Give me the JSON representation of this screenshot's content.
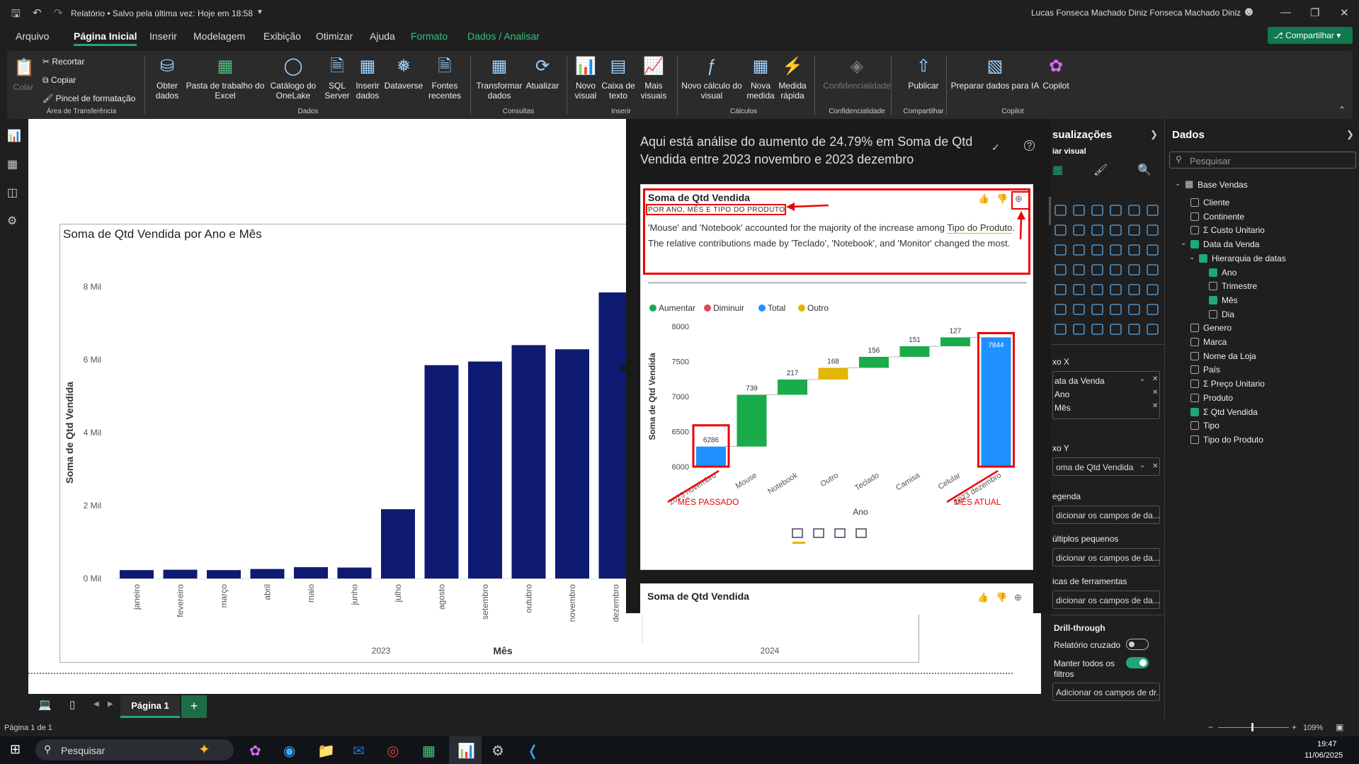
{
  "titlebar": {
    "title": "Relatório • Salvo pela última vez: Hoje em 18:58",
    "user": "Lucas Fonseca Machado Diniz Fonseca Machado Diniz"
  },
  "menu": {
    "tabs": [
      "Arquivo",
      "Página Inicial",
      "Inserir",
      "Modelagem",
      "Exibição",
      "Otimizar",
      "Ajuda",
      "Formato",
      "Dados / Analisar"
    ],
    "share": "Compartilhar"
  },
  "ribbon": {
    "clipboard": {
      "colar": "Colar",
      "recortar": "Recortar",
      "copiar": "Copiar",
      "pincel": "Pincel de formatação",
      "group": "Área de Transferência"
    },
    "dados": {
      "obter": "Obter dados",
      "excel": "Pasta de trabalho do Excel",
      "onelake": "Catálogo do OneLake",
      "sql": "SQL Server",
      "inserir": "Inserir dados",
      "dataverse": "Dataverse",
      "fontes": "Fontes recentes",
      "group": "Dados"
    },
    "consultas": {
      "transformar": "Transformar dados",
      "atualizar": "Atualizar",
      "group": "Consultas"
    },
    "inserir": {
      "novo": "Novo visual",
      "caixa": "Caixa de texto",
      "mais": "Mais visuais",
      "group": "Inserir"
    },
    "calculos": {
      "calc": "Novo cálculo do visual",
      "medida": "Nova medida",
      "rapida": "Medida rápida",
      "group": "Cálculos"
    },
    "conf": {
      "label": "Confidencialidade",
      "group": "Confidencialidade"
    },
    "compart": {
      "publicar": "Publicar",
      "group": "Compartilhar"
    },
    "copilot": {
      "preparar": "Preparar dados para IA",
      "copilot": "Copilot",
      "group": "Copilot"
    }
  },
  "main_chart": {
    "title": "Soma de Qtd Vendida por Ano e Mês",
    "xlabel": "Mês",
    "ylabel": "Soma de Qtd Vendida"
  },
  "qa": {
    "header": "Aqui está análise do aumento de 24.79% em Soma de Qtd Vendida entre 2023 novembro e 2023 dezembro",
    "card_title": "Soma de Qtd Vendida",
    "card_sub": "POR ANO, MÊS E TIPO DO PRODUTO",
    "text1": "'Mouse' and 'Notebook' accounted for the majority of the increase among",
    "text_link": "Tipo do Produto",
    "text2": ". The relative contributions made by 'Teclado', 'Notebook', and 'Monitor' changed the most.",
    "legend": [
      "Aumentar",
      "Diminuir",
      "Total",
      "Outro"
    ],
    "annot_left": "MÊS PASSADO",
    "annot_right": "MÊS ATUAL",
    "card2_title": "Soma de Qtd Vendida"
  },
  "chart_data": [
    {
      "type": "bar",
      "title": "Soma de Qtd Vendida por Ano e Mês",
      "xlabel": "Mês",
      "ylabel": "Soma de Qtd Vendida",
      "ylim": [
        0,
        8000
      ],
      "yticks": [
        "0 Mil",
        "2 Mil",
        "4 Mil",
        "6 Mil",
        "8 Mil"
      ],
      "groups": [
        {
          "name": "2023",
          "count": 12
        },
        {
          "name": "2024",
          "count": 1
        }
      ],
      "categories": [
        "janeiro",
        "fevereiro",
        "março",
        "abril",
        "maio",
        "junho",
        "julho",
        "agosto",
        "setembro",
        "outubro",
        "novembro",
        "dezembro"
      ],
      "values": [
        230,
        240,
        230,
        260,
        310,
        300,
        1900,
        5850,
        5950,
        6400,
        6286,
        7844
      ],
      "color": "#0f1a73",
      "grid": false
    },
    {
      "type": "bar",
      "subtype": "waterfall",
      "xlabel": "Ano",
      "ylabel": "Soma de Qtd Vendida",
      "ylim": [
        6000,
        8000
      ],
      "yticks": [
        6000,
        6500,
        7000,
        7500,
        8000
      ],
      "categories": [
        "2023 novembro",
        "Mouse",
        "Notebook",
        "Outro",
        "Teclado",
        "Camisa",
        "Celular",
        "2023 dezembro"
      ],
      "values": [
        6286,
        739,
        217,
        168,
        156,
        151,
        127,
        7844
      ],
      "kinds": [
        "total",
        "increase",
        "increase",
        "other",
        "increase",
        "increase",
        "increase",
        "total"
      ],
      "colors": {
        "increase": "#1aab4b",
        "decrease": "#e0475b",
        "total": "#1e90ff",
        "other": "#e3b505"
      },
      "legend": [
        "Aumentar",
        "Diminuir",
        "Total",
        "Outro"
      ]
    }
  ],
  "vis": {
    "title": "sualizações",
    "build": "iar visual",
    "eixo_x": "xo X",
    "wells_x": [
      "ata da Venda",
      "Ano",
      "Mês"
    ],
    "eixo_y": "xo Y",
    "wells_y": [
      "oma de Qtd Vendida"
    ],
    "legenda": "egenda",
    "add1": "dicionar os campos de da...",
    "multiplos": "últiplos pequenos",
    "add2": "dicionar os campos de da...",
    "dicas": "icas de ferramentas",
    "add3": "dicionar os campos de da...",
    "drill": "Drill-through",
    "cruzado": "Relatório cruzado",
    "manter": "Manter todos os filtros",
    "add4": "Adicionar os campos de dr..."
  },
  "data_pane": {
    "title": "Dados",
    "search_placeholder": "Pesquisar",
    "table": "Base Vendas",
    "fields": [
      {
        "label": "Cliente",
        "checked": false,
        "sigma": false,
        "level": 1
      },
      {
        "label": "Continente",
        "checked": false,
        "sigma": false,
        "level": 1
      },
      {
        "label": "Custo Unitario",
        "checked": false,
        "sigma": true,
        "level": 1
      },
      {
        "label": "Data da Venda",
        "checked": true,
        "sigma": false,
        "level": 0
      },
      {
        "label": "Hierarquia de datas",
        "checked": true,
        "sigma": false,
        "level": 2
      },
      {
        "label": "Ano",
        "checked": true,
        "sigma": false,
        "level": 3
      },
      {
        "label": "Trimestre",
        "checked": false,
        "sigma": false,
        "level": 3
      },
      {
        "label": "Mês",
        "checked": true,
        "sigma": false,
        "level": 3
      },
      {
        "label": "Dia",
        "checked": false,
        "sigma": false,
        "level": 3
      },
      {
        "label": "Genero",
        "checked": false,
        "sigma": false,
        "level": 1
      },
      {
        "label": "Marca",
        "checked": false,
        "sigma": false,
        "level": 1
      },
      {
        "label": "Nome da Loja",
        "checked": false,
        "sigma": false,
        "level": 1
      },
      {
        "label": "País",
        "checked": false,
        "sigma": false,
        "level": 1
      },
      {
        "label": "Preço Unitario",
        "checked": false,
        "sigma": true,
        "level": 1
      },
      {
        "label": "Produto",
        "checked": false,
        "sigma": false,
        "level": 1
      },
      {
        "label": "Qtd Vendida",
        "checked": true,
        "sigma": true,
        "level": 1
      },
      {
        "label": "Tipo",
        "checked": false,
        "sigma": false,
        "level": 1
      },
      {
        "label": "Tipo do Produto",
        "checked": false,
        "sigma": false,
        "level": 1
      }
    ]
  },
  "pages": {
    "tab": "Página 1",
    "add": "+"
  },
  "status": {
    "page": "Página 1 de 1",
    "zoom": "109%"
  },
  "taskbar": {
    "search": "Pesquisar",
    "time": "19:47",
    "date": "11/06/2025"
  }
}
